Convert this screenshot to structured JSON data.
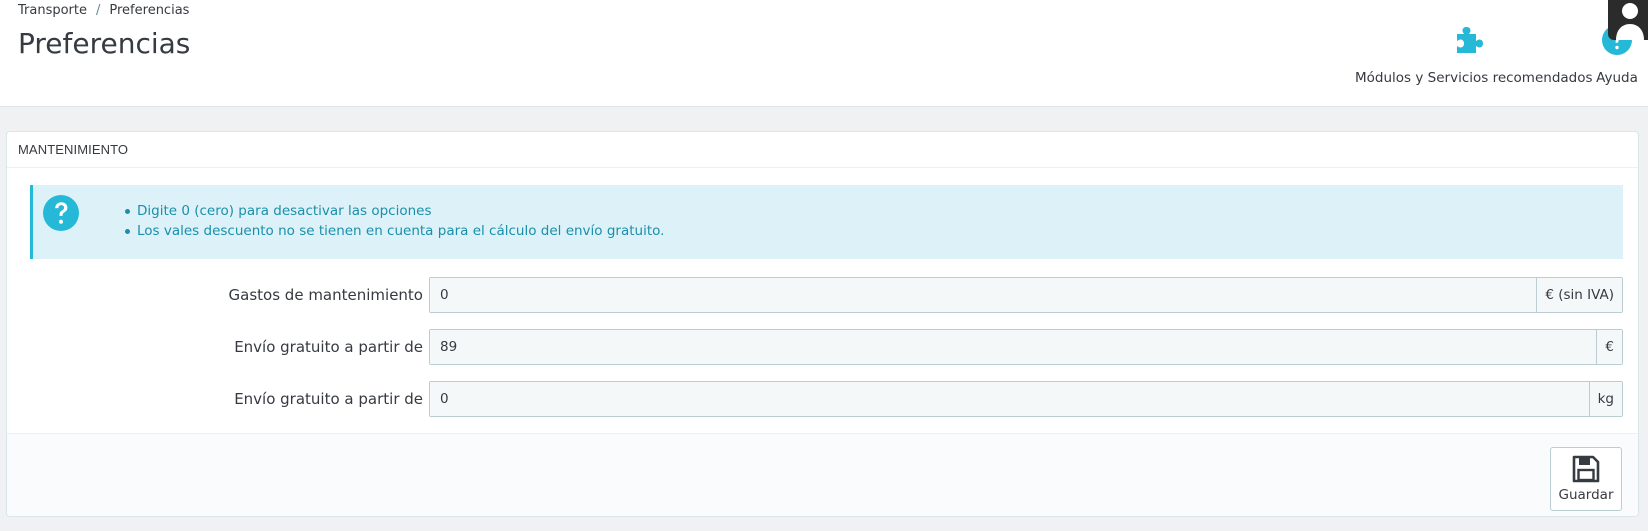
{
  "breadcrumb": {
    "parent": "Transporte",
    "separator": "/",
    "current": "Preferencias"
  },
  "page_title": "Preferencias",
  "toolbar": {
    "modules_label": "Módulos y Servicios recomendados",
    "help_label": "Ayuda"
  },
  "panel": {
    "heading": "Mantenimiento",
    "alert": {
      "items": [
        "Digite 0 (cero) para desactivar las opciones",
        "Los vales descuento no se tienen en cuenta para el cálculo del envío gratuito."
      ]
    },
    "fields": [
      {
        "label": "Gastos de mantenimiento",
        "value": "0",
        "suffix": "€ (sin IVA)"
      },
      {
        "label": "Envío gratuito a partir de",
        "value": "89",
        "suffix": "€"
      },
      {
        "label": "Envío gratuito a partir de",
        "value": "0",
        "suffix": "kg"
      }
    ],
    "save_label": "Guardar"
  },
  "colors": {
    "accent": "#25b9d7",
    "alert_bg": "#dcf2f8",
    "alert_text": "#1a8fab",
    "text": "#363a41",
    "page_bg": "#eff1f2"
  },
  "icons": [
    "puzzle-icon",
    "help-icon",
    "user-avatar-icon",
    "question-circle-icon",
    "save-icon"
  ]
}
